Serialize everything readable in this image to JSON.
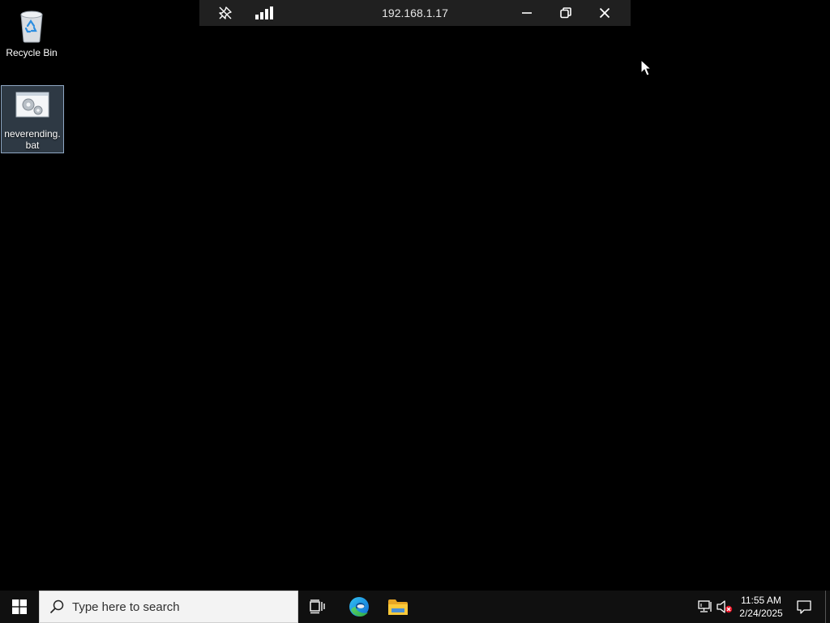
{
  "desktop": {
    "icons": [
      {
        "label": "Recycle Bin",
        "icon": "recycle-bin-icon"
      },
      {
        "label": "neverending.\nbat",
        "icon": "batch-file-icon",
        "selected": true
      }
    ]
  },
  "rdp_bar": {
    "title": "192.168.1.17",
    "buttons": [
      "pin-icon",
      "connection-signal-icon",
      "minimize-icon",
      "restore-icon",
      "close-icon"
    ]
  },
  "taskbar": {
    "search": {
      "placeholder": "Type here to search"
    },
    "apps": [
      "task-view-icon",
      "edge-icon",
      "file-explorer-icon"
    ],
    "tray": {
      "time": "11:55 AM",
      "date": "2/24/2025",
      "icons": [
        "network-icon",
        "volume-muted-icon",
        "notification-icon"
      ]
    }
  },
  "colors": {
    "desktop_background": "#000000",
    "taskbar": "#101010",
    "rdp_bar": "#202020",
    "selection": "#4a6078"
  }
}
